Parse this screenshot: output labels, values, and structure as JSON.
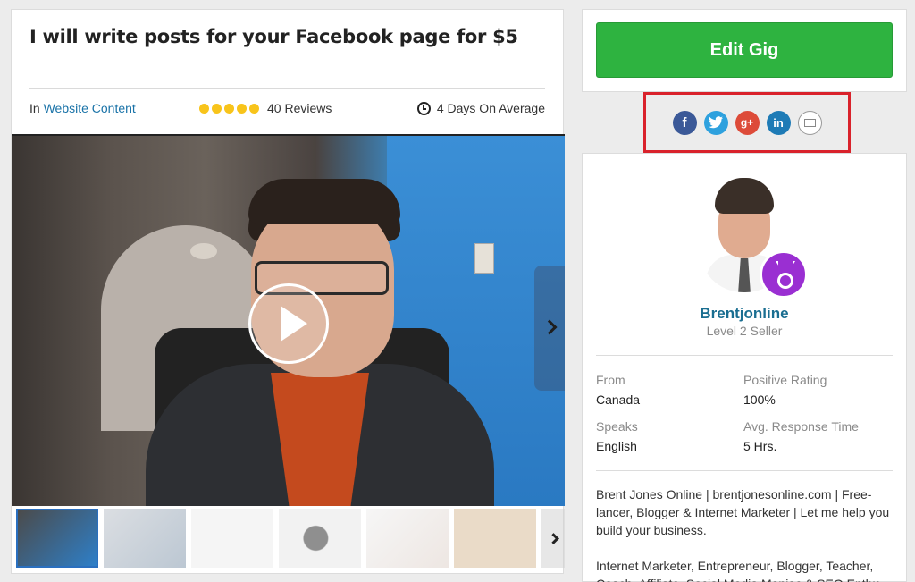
{
  "gig": {
    "title": "I will write posts for your Facebook page for $5",
    "category_prefix": "In",
    "category": "Website Content",
    "rating_stars": 5,
    "reviews": "40 Reviews",
    "delivery": "4 Days On Average"
  },
  "actions": {
    "edit_label": "Edit Gig"
  },
  "share": {
    "icons": [
      "facebook-icon",
      "twitter-icon",
      "google-plus-icon",
      "linkedin-icon",
      "email-icon"
    ],
    "facebook": "f",
    "google": "g+",
    "linkedin": "in",
    "highlight_color": "#d9222b"
  },
  "seller": {
    "name": "Brentjonline",
    "level": "Level 2 Seller",
    "from_label": "From",
    "from_value": "Canada",
    "rating_label": "Positive Rating",
    "rating_value": "100%",
    "speaks_label": "Speaks",
    "speaks_value": "English",
    "response_label": "Avg. Response Time",
    "response_value": "5 Hrs.",
    "bio": "Brent Jones Online | brentjonesonline.com | Free-lancer, Blogger & Internet Marketer | Let me help you build your business.",
    "bio2": "Internet Marketer, Entrepreneur, Blogger, Teacher, Coach, Affiliate, Social Media Maniac & SEO Enthu"
  },
  "colors": {
    "accent_green": "#2eb340",
    "link_blue": "#1a73a8",
    "badge_purple": "#9a2fd2",
    "star_yellow": "#f8c41b"
  }
}
